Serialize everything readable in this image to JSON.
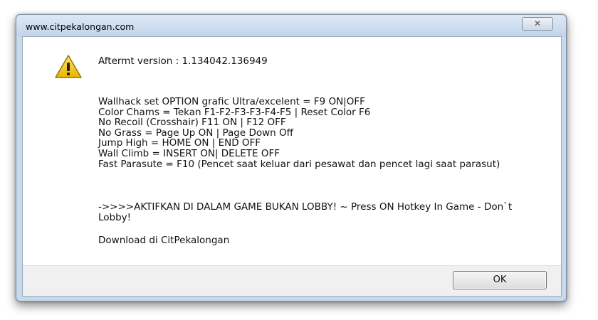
{
  "window": {
    "title": "www.citpekalongan.com",
    "close_label": "✕"
  },
  "message": {
    "icon": "warning-icon",
    "header": "Aftermt version : 1.134042.136949",
    "lines": [
      "Wallhack set OPTION grafic Ultra/excelent = F9 ON|OFF",
      "Color Chams = Tekan F1-F2-F3-F3-F4-F5 | Reset Color F6",
      "No Recoil (Crosshair) F11 ON | F12 OFF",
      "No Grass = Page Up ON | Page Down Off",
      "Jump High = HOME ON | END OFF",
      "Wall Climb = INSERT ON| DELETE OFF",
      "Fast Parasute = F10 (Pencet saat keluar dari pesawat dan pencet lagi saat parasut)"
    ],
    "notice": "->>>>AKTIFKAN DI DALAM GAME BUKAN LOBBY! ~ Press ON Hotkey In Game - Don`t Lobby!",
    "download": "Download di CitPekalongan"
  },
  "buttons": {
    "ok_label": "OK"
  },
  "colors": {
    "titlebar": "#c9d9ec",
    "warning_fill": "#f2c200"
  }
}
